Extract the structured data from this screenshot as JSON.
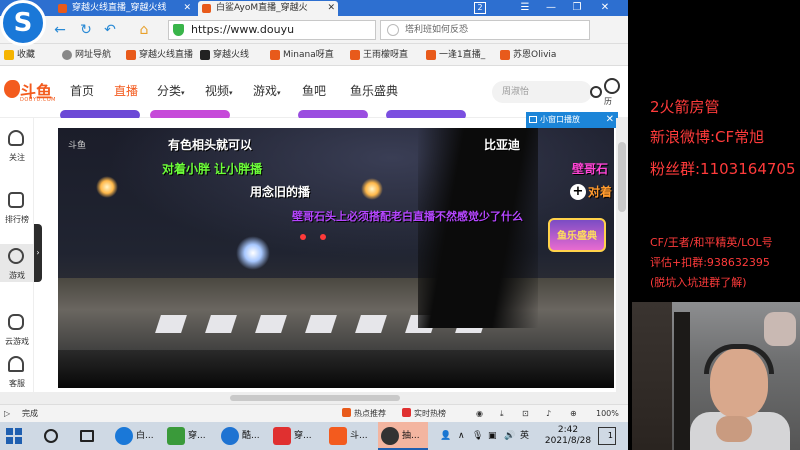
{
  "browser": {
    "tabs": [
      {
        "label": "穿越火线直播_穿越火线",
        "active": false
      },
      {
        "label": "白鲨AyoM直播_穿越火",
        "active": true
      }
    ],
    "window_badge": "2",
    "address": "https://www.douyu",
    "search_placeholder": "塔利班如何反恐",
    "bookmarks": [
      {
        "label": "收藏",
        "color": "#f5b400"
      },
      {
        "label": "网址导航",
        "color": "#888888"
      },
      {
        "label": "穿越火线直播",
        "color": "#e85a1b"
      },
      {
        "label": "穿越火线",
        "color": "#222222"
      },
      {
        "label": "Minana呀直",
        "color": "#e85a1b"
      },
      {
        "label": "王雨檬呀直",
        "color": "#e85a1b"
      },
      {
        "label": "一逢1直播_",
        "color": "#e85a1b"
      },
      {
        "label": "苏恩Olivia",
        "color": "#e85a1b"
      }
    ]
  },
  "site": {
    "logo_text": "斗鱼",
    "logo_sub": "DOUYU.COM",
    "nav": [
      {
        "label": "首页",
        "active": false,
        "caret": false
      },
      {
        "label": "直播",
        "active": true,
        "caret": false
      },
      {
        "label": "分类",
        "active": false,
        "caret": true
      },
      {
        "label": "视频",
        "active": false,
        "caret": true
      },
      {
        "label": "游戏",
        "active": false,
        "caret": true
      },
      {
        "label": "鱼吧",
        "active": false,
        "caret": false
      },
      {
        "label": "鱼乐盛典",
        "active": false,
        "caret": false
      }
    ],
    "search_placeholder": "周淑怡",
    "history_label": "历",
    "sidebar": [
      {
        "label": "关注",
        "icon": "heart-icon"
      },
      {
        "label": "排行榜",
        "icon": "ranking-icon"
      },
      {
        "label": "游戏",
        "icon": "game-icon"
      },
      {
        "label": "云游戏",
        "icon": "gamepad-icon"
      },
      {
        "label": "客服",
        "icon": "headset-icon"
      }
    ],
    "mini_player_label": "小窗口播放"
  },
  "video": {
    "watermark": "斗鱼",
    "danmu": [
      {
        "text": "有色相头就可以",
        "color": "#ffffff"
      },
      {
        "text": "比亚迪",
        "color": "#ffffff"
      },
      {
        "text": "对着小胖 让小胖播",
        "color": "#6dff3a"
      },
      {
        "text": "壁哥石",
        "color": "#ff45d6"
      },
      {
        "text": "用念旧的播",
        "color": "#ffffff"
      },
      {
        "text": "对着",
        "color": "#ff9a2e"
      },
      {
        "text": "壁哥石头上必须搭配老白直播不然感觉少了什么",
        "color": "#b546ff"
      }
    ],
    "badge_text": "鱼乐盛典"
  },
  "statusbar": {
    "left": "完成",
    "items": [
      {
        "label": "热点推荐",
        "color": "#e85a1b"
      },
      {
        "label": "实时热榜",
        "color": "#e03030"
      }
    ],
    "zoom": "100%"
  },
  "taskbar": {
    "apps": [
      {
        "label": "白...",
        "color": "#1a78d8",
        "active": false
      },
      {
        "label": "穿...",
        "color": "#3a9a3a",
        "active": false
      },
      {
        "label": "酷...",
        "color": "#1e73d2",
        "active": false
      },
      {
        "label": "穿...",
        "color": "#e03030",
        "active": false
      },
      {
        "label": "斗...",
        "color": "#f35b1e",
        "active": false
      },
      {
        "label": "抽...",
        "color": "#333333",
        "active": true
      }
    ],
    "ime": "英",
    "time": "2:42",
    "date": "2021/8/28",
    "notifications": "1"
  },
  "overlay": {
    "lines": [
      {
        "text": "2火箭房管",
        "size": 15
      },
      {
        "text": "新浪微博:CF常旭",
        "size": 15
      },
      {
        "text": "粉丝群:1103164705",
        "size": 15
      },
      {
        "text": "CF/王者/和平精英/LOL号",
        "size": 11
      },
      {
        "text": "评估+扣群:938632395",
        "size": 11
      },
      {
        "text": "(脱坑入坑进群了解)",
        "size": 11
      }
    ],
    "color": "#ff3b3b"
  }
}
